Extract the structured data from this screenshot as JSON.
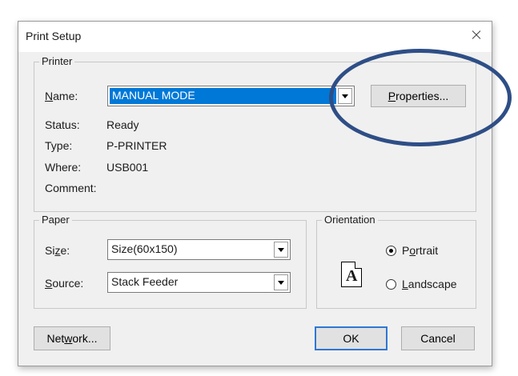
{
  "dialog": {
    "title": "Print Setup",
    "close_label": "Close"
  },
  "printer": {
    "legend": "Printer",
    "name_label_pre": "",
    "name_label_ul": "N",
    "name_label_post": "ame:",
    "name_value": "MANUAL MODE",
    "properties_pre": "",
    "properties_ul": "P",
    "properties_post": "roperties...",
    "status_label": "Status:",
    "status_value": "Ready",
    "type_label": "Type:",
    "type_value": "P-PRINTER",
    "where_label": "Where:",
    "where_value": "USB001",
    "comment_label": "Comment:",
    "comment_value": ""
  },
  "paper": {
    "legend": "Paper",
    "size_label_pre": "Si",
    "size_label_ul": "z",
    "size_label_post": "e:",
    "size_value": "Size(60x150)",
    "source_label_pre": "",
    "source_label_ul": "S",
    "source_label_post": "ource:",
    "source_value": "Stack Feeder"
  },
  "orientation": {
    "legend": "Orientation",
    "portrait_pre": "P",
    "portrait_ul": "o",
    "portrait_post": "rtrait",
    "landscape_pre": "",
    "landscape_ul": "L",
    "landscape_post": "andscape",
    "selected": "Portrait",
    "page_glyph": "A"
  },
  "buttons": {
    "network_pre": "Net",
    "network_ul": "w",
    "network_post": "ork...",
    "ok": "OK",
    "cancel": "Cancel"
  },
  "annotation": {
    "color": "#2e4e86"
  }
}
